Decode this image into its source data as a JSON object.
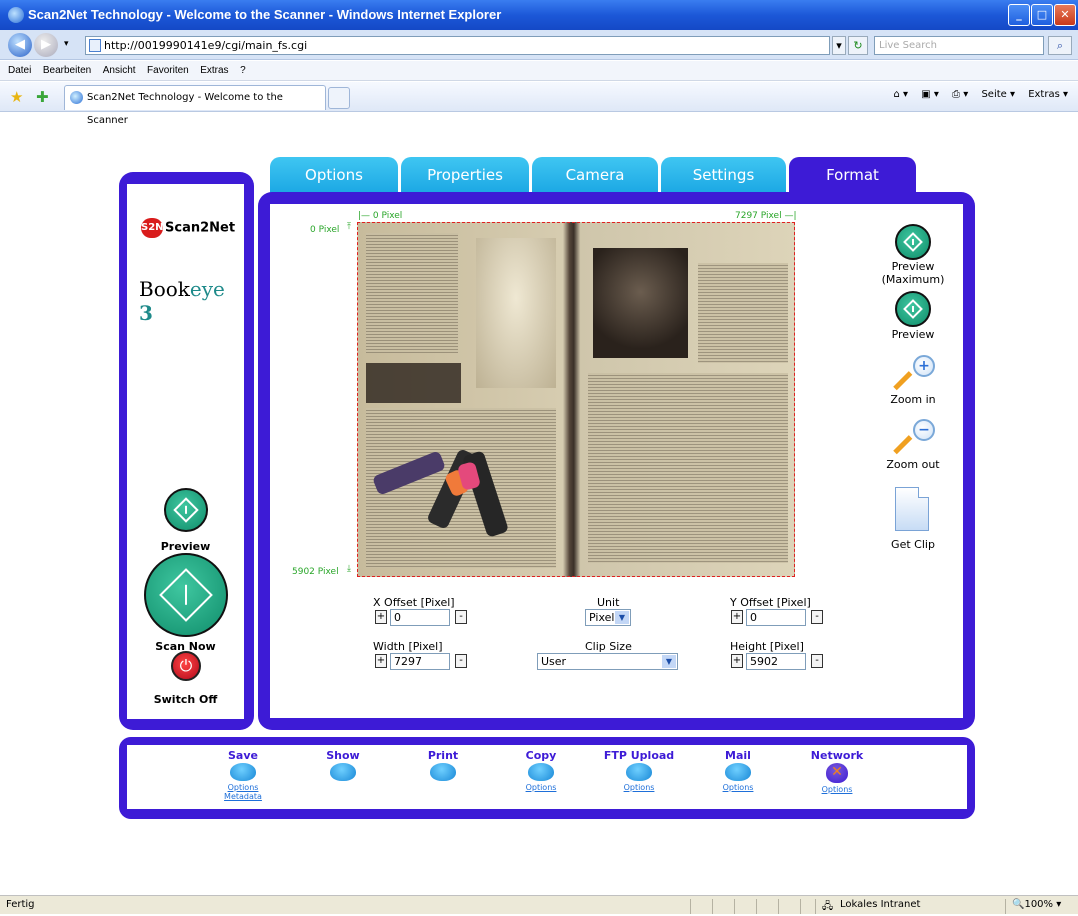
{
  "browser": {
    "title": "Scan2Net Technology - Welcome to the Scanner - Windows Internet Explorer",
    "url": "http://0019990141e9/cgi/main_fs.cgi",
    "search_placeholder": "Live Search",
    "menu": [
      "Datei",
      "Bearbeiten",
      "Ansicht",
      "Favoriten",
      "Extras",
      "?"
    ],
    "tab_title": "Scan2Net Technology - Welcome to the Scanner",
    "tools": [
      "Seite ▾",
      "Extras ▾"
    ],
    "status_left": "Fertig",
    "status_zone": "Lokales Intranet",
    "zoom": "100%"
  },
  "left": {
    "logo_text": "Scan2Net",
    "logo_badge": "S2N",
    "product_a": "Book",
    "product_b": "eye",
    "product_c": "3",
    "preview_label": "Preview",
    "scan_label": "Scan Now",
    "switch_label": "Switch Off"
  },
  "tabs": [
    "Options",
    "Properties",
    "Camera",
    "Settings",
    "Format"
  ],
  "active_tab": "Format",
  "preview_area": {
    "top_left": "|— 0 Pixel",
    "top_right": "7297 Pixel —|",
    "left_top": "0 Pixel",
    "left_bottom": "5902 Pixel"
  },
  "right_buttons": {
    "preview_max": "Preview (Maximum)",
    "preview": "Preview",
    "zoom_in": "Zoom in",
    "zoom_out": "Zoom out",
    "get_clip": "Get Clip"
  },
  "fields": {
    "x_offset_label": "X Offset [Pixel]",
    "x_offset_value": "0",
    "unit_label": "Unit",
    "unit_value": "Pixel",
    "y_offset_label": "Y Offset [Pixel]",
    "y_offset_value": "0",
    "width_label": "Width [Pixel]",
    "width_value": "7297",
    "clip_label": "Clip Size",
    "clip_value": "User",
    "height_label": "Height [Pixel]",
    "height_value": "5902"
  },
  "outputs": [
    {
      "label": "Save",
      "links": [
        "Options",
        "Metadata"
      ]
    },
    {
      "label": "Show",
      "links": []
    },
    {
      "label": "Print",
      "links": []
    },
    {
      "label": "Copy",
      "links": [
        "Options"
      ]
    },
    {
      "label": "FTP Upload",
      "links": [
        "Options"
      ]
    },
    {
      "label": "Mail",
      "links": [
        "Options"
      ]
    },
    {
      "label": "Network",
      "links": [
        "Options"
      ]
    }
  ],
  "colors": {
    "frame": "#3d1bd6",
    "tab": "#1aa6e3",
    "go_button": "#0f8c6a",
    "off_button": "#b10a1c"
  }
}
